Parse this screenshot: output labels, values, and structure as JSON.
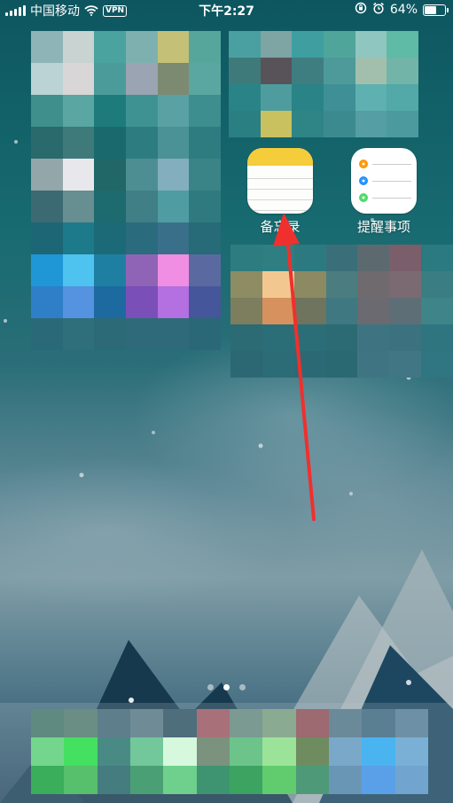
{
  "status_bar": {
    "carrier": "中国移动",
    "vpn_label": "VPN",
    "time": "下午2:27",
    "battery_percent": "64%",
    "battery_level": 0.64,
    "icons": [
      "signal-icon",
      "wifi-icon",
      "orientation-lock-icon",
      "alarm-icon",
      "battery-icon"
    ]
  },
  "apps": [
    {
      "label": "备忘录",
      "icon": "notes-icon"
    },
    {
      "label": "提醒事项",
      "icon": "reminders-icon",
      "dot_colors": [
        "#ff9500",
        "#1e90ff",
        "#4cd964"
      ]
    }
  ],
  "page_indicator": {
    "pages": 3,
    "current": 2
  },
  "colors": {
    "arrow": "#f0302d",
    "notes_header": "#f5cc3a"
  },
  "mosaics": {
    "widget_left": [
      [
        "#8fb4b8",
        "#c9d3d2",
        "#4aa39f",
        "#7fb0b0",
        "#c4c077",
        "#57a69c"
      ],
      [
        "#bcd3d6",
        "#d8d6d6",
        "#4b9b9a",
        "#9aa4b3",
        "#7d8a72",
        "#5aa7a1"
      ],
      [
        "#3f8f8c",
        "#5aa6a3",
        "#1e7b7c",
        "#3f9292",
        "#59a1a3",
        "#3d8e8e"
      ],
      [
        "#2a6a6c",
        "#3f7a7b",
        "#1a6a6d",
        "#2d7c80",
        "#4b9297",
        "#2e7b80"
      ],
      [
        "#93a6aa",
        "#e8e8ec",
        "#216768",
        "#4d8e92",
        "#82aebd",
        "#3a8386"
      ],
      [
        "#3b6a73",
        "#678e90",
        "#1d6a6f",
        "#3f7f85",
        "#4f9ca3",
        "#2f7a7f"
      ],
      [
        "#1c6675",
        "#1d7a8a",
        "#1c6a78",
        "#2a6b7e",
        "#3a6f8a",
        "#276a78"
      ],
      [
        "#1f97d6",
        "#4fc3f0",
        "#1f7fa3",
        "#8f64b6",
        "#ef8ee2",
        "#5a6aa0"
      ],
      [
        "#2f7ec8",
        "#5592e0",
        "#1c6aa0",
        "#7a4fb8",
        "#b46fe0",
        "#46569a"
      ],
      [
        "#2a6a78",
        "#2f6f7c",
        "#2c6a78",
        "#2f6a7a",
        "#2e6a7a",
        "#2a6878"
      ]
    ],
    "widget_top_right": [
      [
        "#4aa0a0",
        "#7fa4a4",
        "#3f9ea0",
        "#4fa59a",
        "#8fc6c0",
        "#5fbaa6"
      ],
      [
        "#3f7a7a",
        "#585358",
        "#3f7e80",
        "#4e9a9a",
        "#a2bfae",
        "#72b4a8"
      ],
      [
        "#2a8386",
        "#4e9c9e",
        "#2a8386",
        "#3f8f96",
        "#5fb0b0",
        "#53a8a8"
      ],
      [
        "#2a7f82",
        "#c9c060",
        "#2f8485",
        "#3b8a90",
        "#549ea4",
        "#4d9a9e"
      ]
    ],
    "widget_mid_right": [
      [
        "#2d7c80",
        "#2e7e82",
        "#2c7a7f",
        "#3a6f7a",
        "#5c6a70",
        "#7a5e6a",
        "#2a7a80"
      ],
      [
        "#8e8c62",
        "#f3c890",
        "#8c8a62",
        "#4b7d80",
        "#6f6a6e",
        "#7b6a72",
        "#3a7e84"
      ],
      [
        "#7c7e5e",
        "#d6915e",
        "#6f745e",
        "#3f7880",
        "#6a6a70",
        "#5e6e76",
        "#3f8488"
      ],
      [
        "#2c6a74",
        "#2c6e78",
        "#2c6e77",
        "#2c6a74",
        "#3e7482",
        "#3c7280",
        "#2f7580"
      ],
      [
        "#2b6874",
        "#2b6c76",
        "#2b6a74",
        "#2a6872",
        "#3f7582",
        "#417685",
        "#307682"
      ]
    ],
    "dock": [
      [
        "#5e8a80",
        "#6a8e84",
        "#5f7e8c",
        "#6f8c96",
        "#4e6e7c",
        "#a8717a",
        "#7a9a92",
        "#8aaa92",
        "#9c6a70",
        "#6a8a9a",
        "#5a7e92",
        "#6e90a6"
      ],
      [
        "#74d68c",
        "#44e060",
        "#4a8a84",
        "#72c89a",
        "#d6f8dc",
        "#7a927e",
        "#6cc48a",
        "#9ce39a",
        "#6e8c60",
        "#7aa8c8",
        "#4ab4f0",
        "#7ab0d6"
      ],
      [
        "#3aae5a",
        "#56c06c",
        "#447c80",
        "#4aa074",
        "#6ed08c",
        "#3e9470",
        "#3ca460",
        "#60cc6e",
        "#4e9a78",
        "#6a96b6",
        "#5aa0e8",
        "#72a4d0"
      ]
    ]
  }
}
